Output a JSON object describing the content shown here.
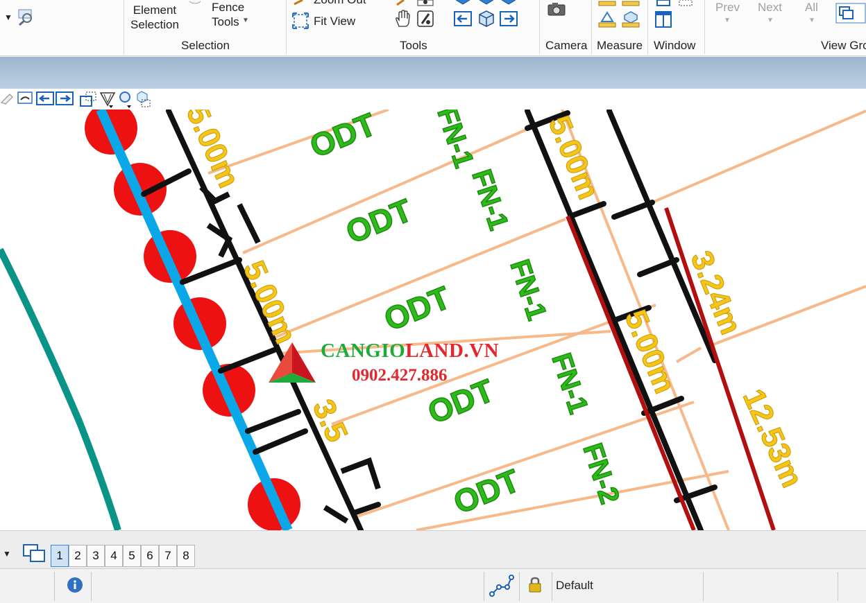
{
  "ribbon": {
    "selection": {
      "element_selection": "Element\nSelection",
      "fence_tools": "Fence\nTools",
      "label": "Selection"
    },
    "tools": {
      "zoom_out": "Zoom Out",
      "fit_view": "Fit View",
      "label": "Tools"
    },
    "camera": {
      "label": "Camera"
    },
    "measure": {
      "label": "Measure"
    },
    "window": {
      "label": "Window"
    },
    "view_groups": {
      "prev": "Prev",
      "next": "Next",
      "all": "All",
      "label": "View Gro"
    }
  },
  "drawing": {
    "dim_labels": [
      "5.00m",
      "5.00m",
      "5.00m",
      "5.00m",
      "3.24m",
      "12.53m",
      "3.5"
    ],
    "lot_codes": [
      "ODT",
      "ODT",
      "ODT",
      "ODT",
      "ODT"
    ],
    "lot_ids": [
      "FN-1",
      "FN-1",
      "FN-1",
      "FN-1",
      "FN-2"
    ]
  },
  "watermark": {
    "brand_a": "CANGIO",
    "brand_b": "LAND.VN",
    "phone": "0902.427.886"
  },
  "view_tabs": [
    "1",
    "2",
    "3",
    "4",
    "5",
    "6",
    "7",
    "8"
  ],
  "status": {
    "level": "Default"
  },
  "colors": {
    "brand_green": "#1faa3a",
    "brand_red": "#e0282e",
    "cyan_line": "#0aa8e8",
    "teal_line": "#0a9488",
    "dim_yellow": "#f5c518",
    "lot_green": "#2dbb1a",
    "boundary_red": "#b20f0f",
    "parcel_orange": "#f8b98a"
  }
}
